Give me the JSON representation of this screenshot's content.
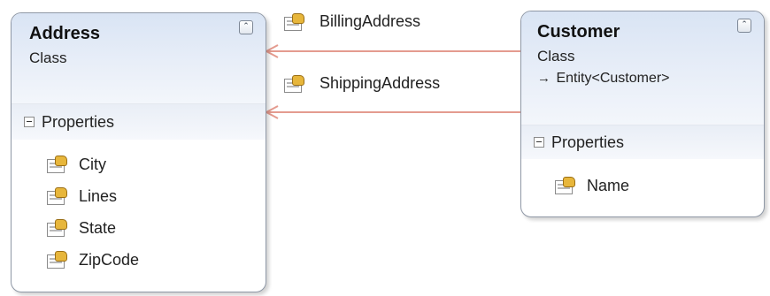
{
  "classes": {
    "address": {
      "name": "Address",
      "kind": "Class",
      "compartment": "Properties",
      "properties": [
        "City",
        "Lines",
        "State",
        "ZipCode"
      ],
      "collapse_glyph": "⌃"
    },
    "customer": {
      "name": "Customer",
      "kind": "Class",
      "base_class": "Entity<Customer>",
      "inherit_glyph": "→",
      "compartment": "Properties",
      "properties": [
        "Name"
      ],
      "collapse_glyph": "⌃"
    }
  },
  "associations": [
    {
      "label": "BillingAddress",
      "from": "Customer",
      "to": "Address"
    },
    {
      "label": "ShippingAddress",
      "from": "Customer",
      "to": "Address"
    }
  ],
  "colors": {
    "connector": "#e49b8f",
    "header_gradient_top": "#d9e4f4",
    "border": "#8f98a6"
  },
  "icons": {
    "property": "property-icon",
    "collapse": "collapse-chevron-icon",
    "compartment_toggle": "minus-box-icon"
  }
}
